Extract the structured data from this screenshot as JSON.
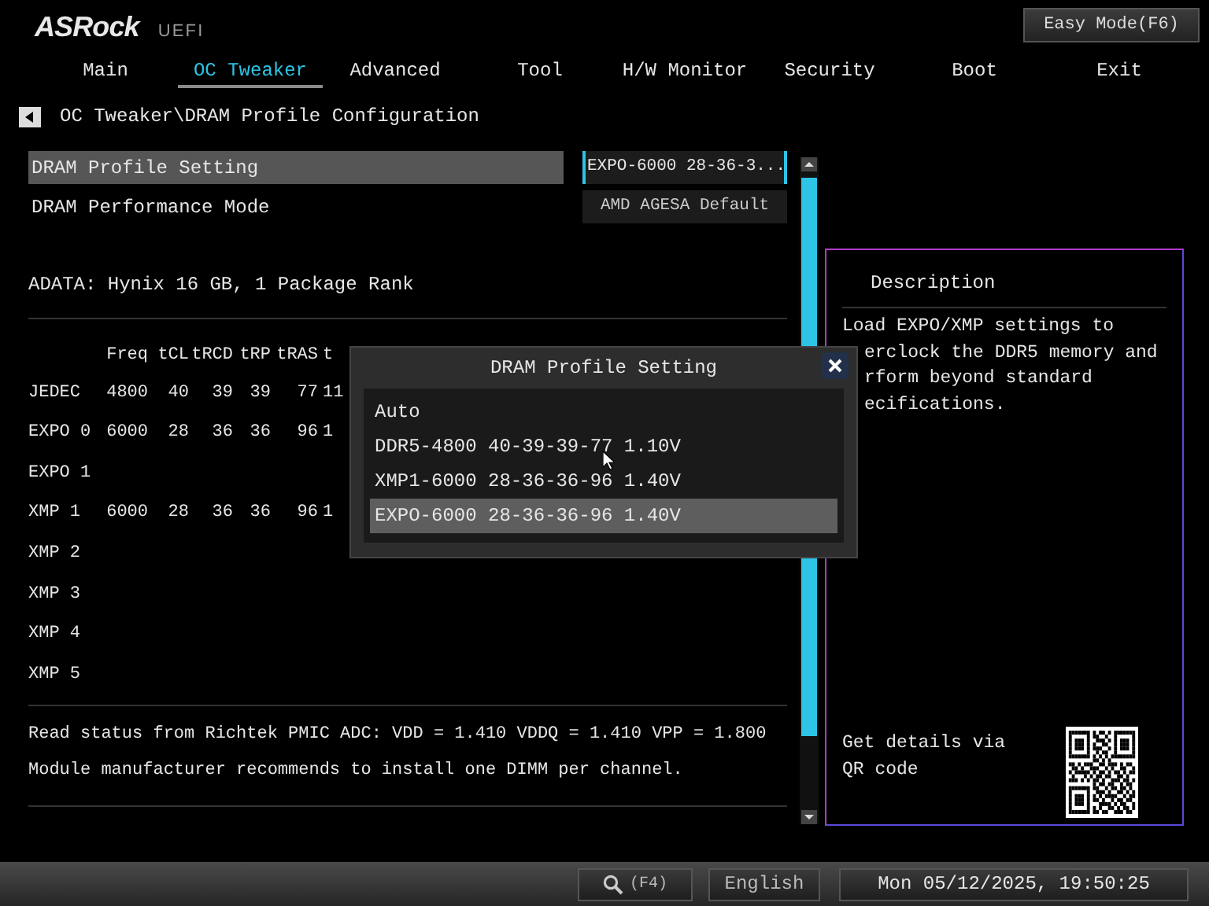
{
  "logo": {
    "brand": "ASRock",
    "sub": "UEFI"
  },
  "easy_mode_button": "Easy Mode(F6)",
  "tabs": [
    {
      "label": "Main",
      "selected": false
    },
    {
      "label": "OC Tweaker",
      "selected": true
    },
    {
      "label": "Advanced",
      "selected": false
    },
    {
      "label": "Tool",
      "selected": false
    },
    {
      "label": "H/W Monitor",
      "selected": false
    },
    {
      "label": "Security",
      "selected": false
    },
    {
      "label": "Boot",
      "selected": false
    },
    {
      "label": "Exit",
      "selected": false
    }
  ],
  "breadcrumb": "OC Tweaker\\DRAM Profile Configuration",
  "settings": [
    {
      "label": "DRAM Profile Setting",
      "value": "EXPO-6000 28-36-3...",
      "selected": true
    },
    {
      "label": "DRAM Performance Mode",
      "value": "AMD AGESA Default",
      "selected": false
    }
  ],
  "module_info": "ADATA: Hynix 16 GB, 1 Package Rank",
  "timing_table": {
    "columns": [
      "Freq",
      "tCL",
      "tRCD",
      "tRP",
      "tRAS",
      "t"
    ],
    "rows": [
      {
        "name": "JEDEC",
        "cells": [
          "4800",
          "40",
          "39",
          "39",
          "77",
          "11"
        ]
      },
      {
        "name": "EXPO 0",
        "cells": [
          "6000",
          "28",
          "36",
          "36",
          "96",
          "1"
        ]
      },
      {
        "name": "EXPO 1",
        "cells": []
      },
      {
        "name": "XMP 1",
        "cells": [
          "6000",
          "28",
          "36",
          "36",
          "96",
          "1"
        ]
      },
      {
        "name": "XMP 2",
        "cells": []
      },
      {
        "name": "XMP 3",
        "cells": []
      },
      {
        "name": "XMP 4",
        "cells": []
      },
      {
        "name": "XMP 5",
        "cells": []
      }
    ]
  },
  "status_lines": [
    "Read status from Richtek PMIC ADC: VDD = 1.410 VDDQ = 1.410 VPP = 1.800",
    "Module manufacturer recommends to install one DIMM per channel."
  ],
  "dialog": {
    "title": "DRAM Profile Setting",
    "options": [
      {
        "label": "Auto",
        "selected": false
      },
      {
        "label": "DDR5-4800 40-39-39-77 1.10V",
        "selected": false
      },
      {
        "label": "XMP1-6000 28-36-36-96 1.40V",
        "selected": false
      },
      {
        "label": "EXPO-6000 28-36-36-96 1.40V",
        "selected": true
      }
    ]
  },
  "description": {
    "title": "Description",
    "lines": [
      "Load EXPO/XMP settings to",
      "erclock the DDR5 memory and",
      "rform beyond standard",
      "ecifications."
    ],
    "qr_caption": "Get details via QR code"
  },
  "bottom_bar": {
    "search_key": "(F4)",
    "language": "English",
    "datetime": "Mon 05/12/2025, 19:50:25"
  }
}
